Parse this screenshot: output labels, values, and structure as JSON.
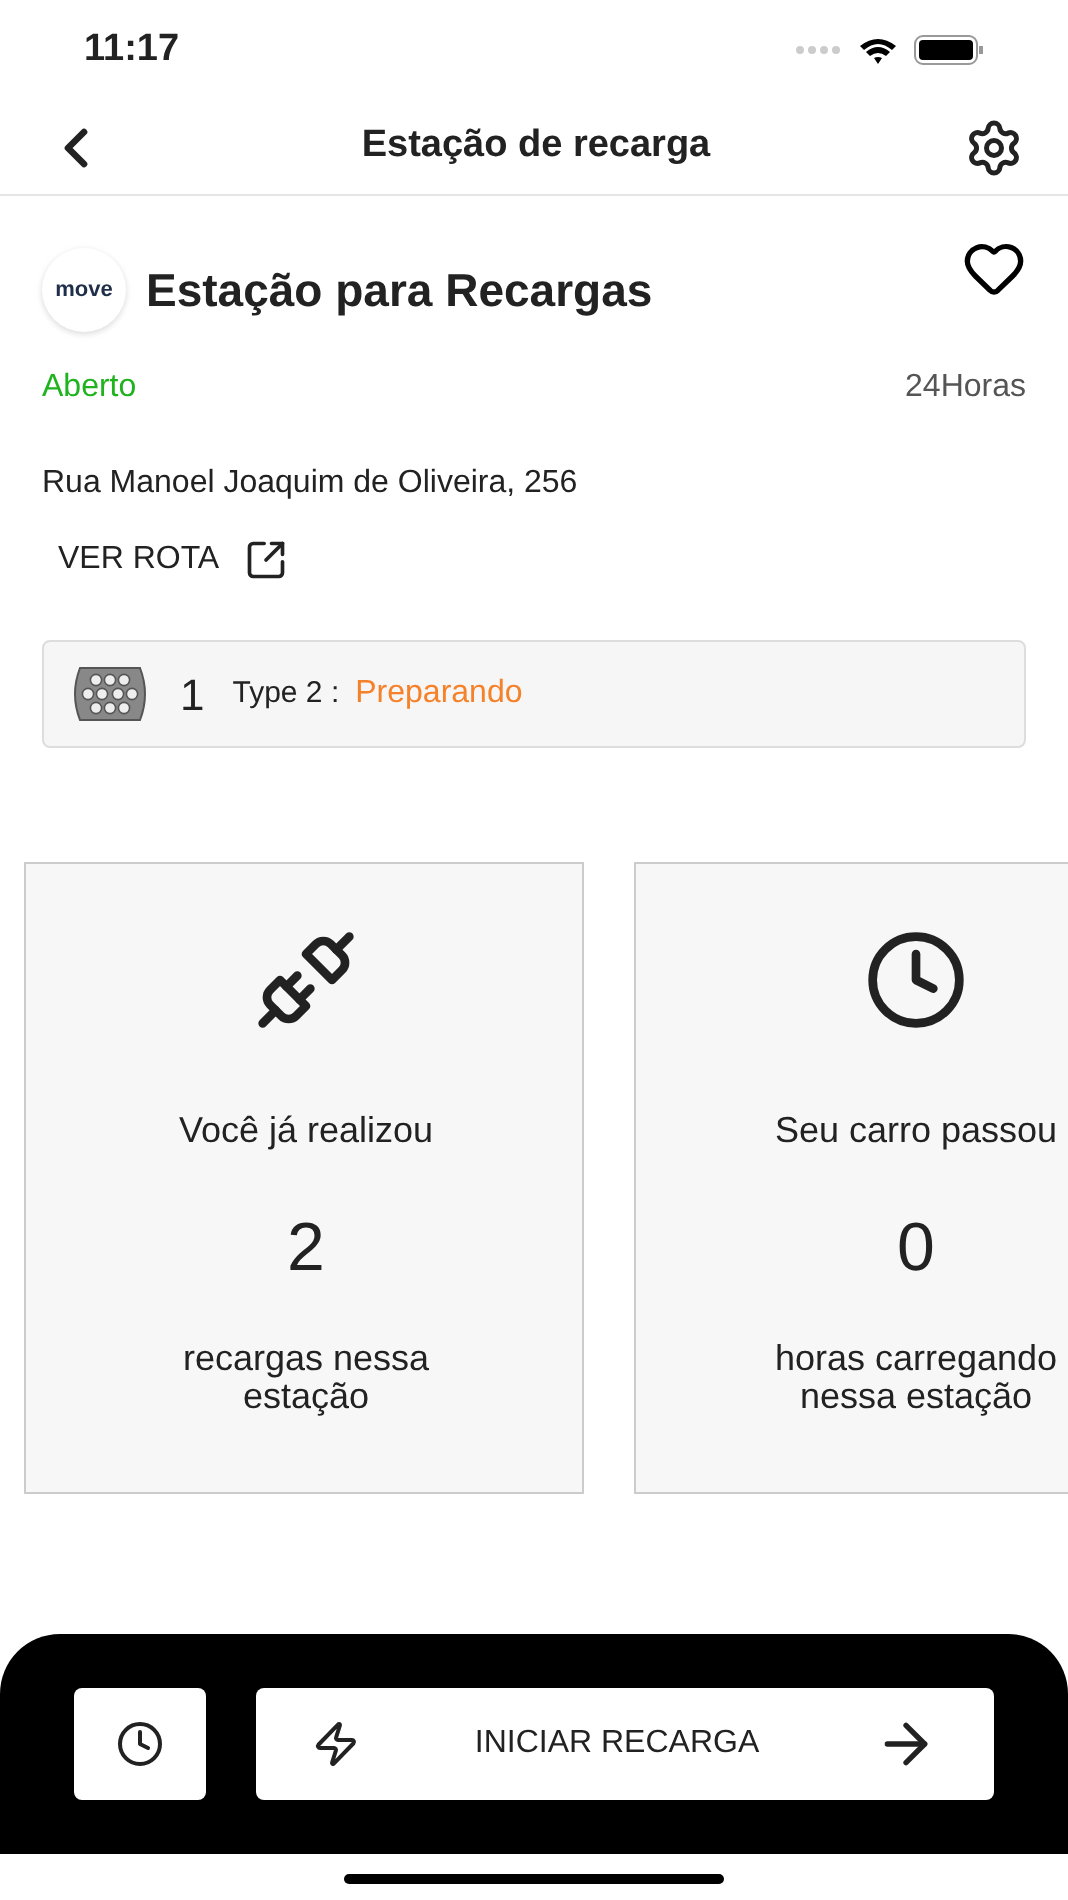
{
  "status_bar": {
    "time": "11:17"
  },
  "nav": {
    "title": "Estação de recarga"
  },
  "station": {
    "logo_text": "move",
    "name": "Estação para Recargas",
    "favorite": false,
    "status": "Aberto",
    "hours": "24Horas",
    "address": "Rua Manoel Joaquim de Oliveira, 256",
    "route_link": "VER ROTA"
  },
  "connectors": [
    {
      "count": "1",
      "type": "Type 2 :",
      "status": "Preparando",
      "color": "#f5822a"
    }
  ],
  "stats": [
    {
      "kind": "plug",
      "heading": "Você já realizou",
      "value": "2",
      "caption": "recargas nessa estação"
    },
    {
      "kind": "clock",
      "heading": "Seu carro passou",
      "value": "0",
      "caption": "horas carregando nessa estação"
    }
  ],
  "actions": {
    "start_button": "INICIAR RECARGA"
  }
}
